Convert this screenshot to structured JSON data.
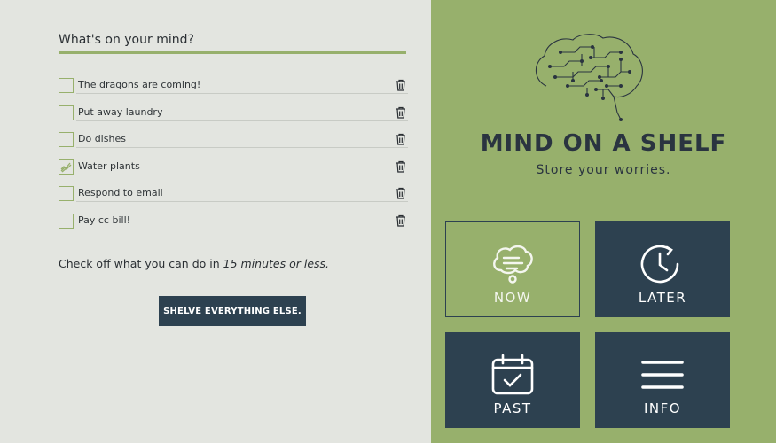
{
  "prompt": "What's on your mind?",
  "todos": [
    {
      "label": "The dragons are coming!",
      "checked": false
    },
    {
      "label": "Put away laundry",
      "checked": false
    },
    {
      "label": "Do dishes",
      "checked": false
    },
    {
      "label": "Water plants",
      "checked": true
    },
    {
      "label": "Respond to email",
      "checked": false
    },
    {
      "label": "Pay cc bill!",
      "checked": false
    }
  ],
  "hint": {
    "text": "Check off what you can do in ",
    "emphasis": "15 minutes or less."
  },
  "shelve_label": "SHELVE EVERYTHING ELSE.",
  "brand": {
    "title": "MIND ON A SHELF",
    "tagline": "Store your worries."
  },
  "tiles": {
    "now": "NOW",
    "later": "LATER",
    "past": "PAST",
    "info": "INFO"
  },
  "colors": {
    "green": "#97b06c",
    "navy": "#2d4150",
    "background": "#e3e5e0"
  },
  "icons": {
    "brain": "circuit-brain-icon",
    "now": "thought-bubble-icon",
    "later": "clock-icon",
    "past": "calendar-check-icon",
    "info": "hamburger-menu-icon",
    "delete": "trash-icon"
  }
}
